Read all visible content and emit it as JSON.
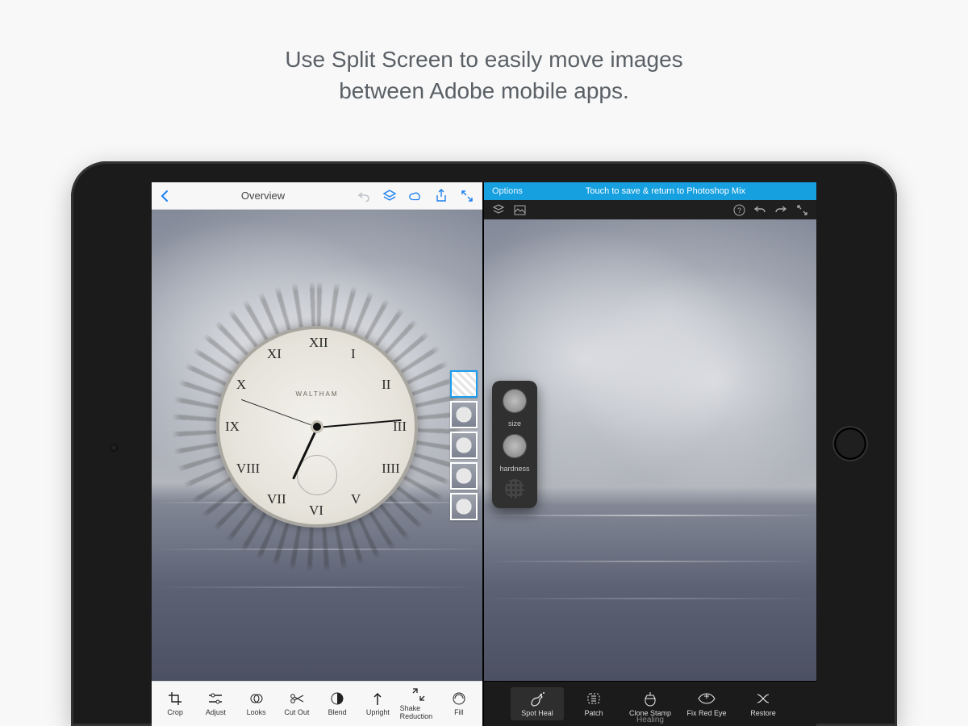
{
  "headline": {
    "line1": "Use Split Screen to easily move images",
    "line2": "between Adobe mobile apps."
  },
  "left_app": {
    "back_icon": "chevron-left",
    "title": "Overview",
    "top_icons": [
      "undo",
      "layers",
      "creative-cloud",
      "share",
      "fullscreen"
    ],
    "clock_brand": "WALTHAM",
    "numerals": [
      "XII",
      "I",
      "II",
      "III",
      "IIII",
      "V",
      "VI",
      "VII",
      "VIII",
      "IX",
      "X",
      "XI"
    ],
    "layer_thumbs": 5,
    "tools": [
      {
        "name": "crop",
        "label": "Crop"
      },
      {
        "name": "adjust",
        "label": "Adjust"
      },
      {
        "name": "looks",
        "label": "Looks"
      },
      {
        "name": "cut-out",
        "label": "Cut Out"
      },
      {
        "name": "blend",
        "label": "Blend"
      },
      {
        "name": "upright",
        "label": "Upright"
      },
      {
        "name": "shake-reduction",
        "label": "Shake Reduction"
      },
      {
        "name": "fill",
        "label": "Fill"
      }
    ]
  },
  "right_app": {
    "options_label": "Options",
    "banner_msg": "Touch to save & return to Photoshop Mix",
    "brush": {
      "size_label": "size",
      "hardness_label": "hardness"
    },
    "tools": [
      {
        "name": "spot-heal",
        "label": "Spot Heal",
        "selected": true
      },
      {
        "name": "patch",
        "label": "Patch"
      },
      {
        "name": "clone-stamp",
        "label": "Clone Stamp"
      },
      {
        "name": "fix-red-eye",
        "label": "Fix Red Eye"
      },
      {
        "name": "restore",
        "label": "Restore"
      }
    ],
    "category_label": "Healing"
  }
}
